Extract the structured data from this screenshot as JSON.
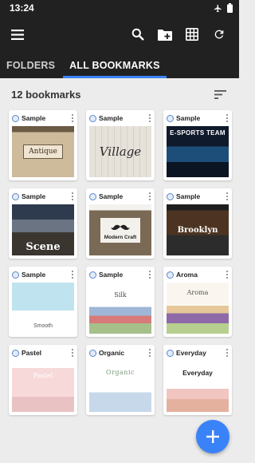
{
  "status": {
    "time": "13:24"
  },
  "tabs": [
    {
      "label": "FOLDERS",
      "active": false
    },
    {
      "label": "ALL BOOKMARKS",
      "active": true
    }
  ],
  "count_label": "12 bookmarks",
  "bookmarks": [
    {
      "title": "Sample",
      "thumb_text": "Antique",
      "theme": "antique"
    },
    {
      "title": "Sample",
      "thumb_text": "Village",
      "theme": "village"
    },
    {
      "title": "Sample",
      "thumb_text": "E-SPORTS TEAM",
      "theme": "esports"
    },
    {
      "title": "Sample",
      "thumb_text": "Scene",
      "theme": "scene"
    },
    {
      "title": "Sample",
      "thumb_text": "Modern Craft",
      "theme": "craft"
    },
    {
      "title": "Sample",
      "thumb_text": "Brooklyn",
      "theme": "brooklyn"
    },
    {
      "title": "Sample",
      "thumb_text": "Smooth",
      "theme": "smooth"
    },
    {
      "title": "Sample",
      "thumb_text": "Silk",
      "theme": "silk"
    },
    {
      "title": "Aroma",
      "thumb_text": "Aroma",
      "theme": "aroma"
    },
    {
      "title": "Pastel",
      "thumb_text": "Pastel",
      "theme": "pastel"
    },
    {
      "title": "Organic",
      "thumb_text": "Organic",
      "theme": "organic"
    },
    {
      "title": "Everyday",
      "thumb_text": "Everyday",
      "theme": "everyday"
    }
  ],
  "colors": {
    "accent": "#3a82f7",
    "appbar": "#212121",
    "background": "#ececec"
  },
  "icons": {
    "menu": "menu-icon",
    "search": "search-icon",
    "new_folder": "create-folder-icon",
    "grid": "grid-view-icon",
    "refresh": "refresh-icon",
    "sort": "sort-icon",
    "more": "more-vert-icon",
    "add": "add-icon"
  }
}
